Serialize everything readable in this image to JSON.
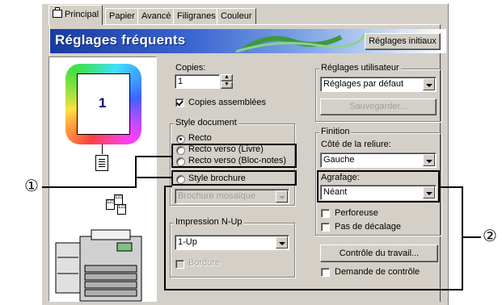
{
  "tabs": [
    "Principal",
    "Papier",
    "Avancé",
    "Filigranes",
    "Couleur"
  ],
  "banner": {
    "title": "Réglages fréquents",
    "reset_button": "Réglages initiaux"
  },
  "preview": {
    "page_number": "1"
  },
  "copies": {
    "label": "Copies:",
    "value": "1",
    "collate_label": "Copies assemblées",
    "collate_checked": true
  },
  "document_style": {
    "label": "Style document",
    "options": [
      "Recto",
      "Recto verso (Livre)",
      "Recto verso (Bloc-notes)",
      "Style brochure"
    ],
    "selected": "Recto",
    "brochure_dropdown": "Brochure mosaïque"
  },
  "nup": {
    "label": "Impression N-Up",
    "value": "1-Up",
    "border_label": "Bordure"
  },
  "user_settings": {
    "label": "Réglages utilisateur",
    "value": "Réglages par défaut",
    "save_button": "Sauvegarder..."
  },
  "finishing": {
    "label": "Finition",
    "binding_label": "Côté de la reliure:",
    "binding_value": "Gauche",
    "staple_label": "Agrafage:",
    "staple_value": "Néant",
    "punch_label": "Perforeuse",
    "offset_label": "Pas de décalage"
  },
  "job_control": {
    "button": "Contrôle du travail...",
    "confirm_label": "Demande de contrôle"
  },
  "callouts": {
    "one": "①",
    "two": "②"
  },
  "colors": {
    "dialog": "#d4d0c8",
    "banner_start": "#1a3aa0",
    "banner_end": "#ffffff"
  }
}
